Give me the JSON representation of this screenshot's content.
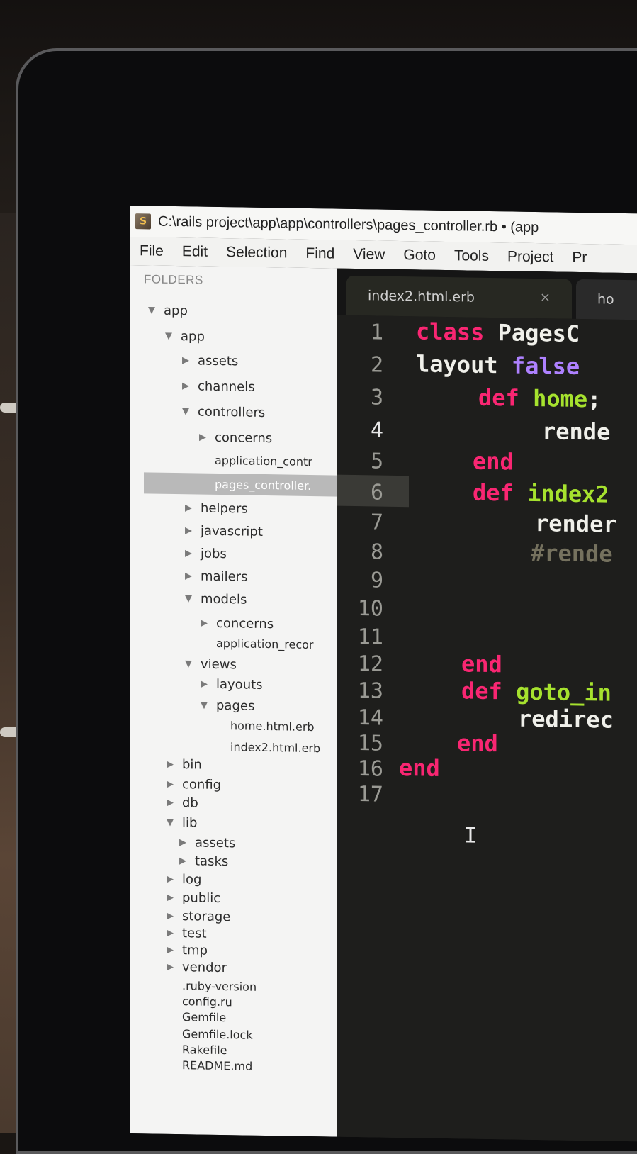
{
  "window": {
    "title": "C:\\rails project\\app\\app\\controllers\\pages_controller.rb • (app",
    "app_icon": "sublime-text-icon"
  },
  "menu": [
    "File",
    "Edit",
    "Selection",
    "Find",
    "View",
    "Goto",
    "Tools",
    "Project",
    "Pr"
  ],
  "sidebar": {
    "header": "FOLDERS",
    "items": [
      {
        "label": "app",
        "state": "open"
      },
      {
        "label": "app",
        "state": "open"
      },
      {
        "label": "assets",
        "state": "closed"
      },
      {
        "label": "channels",
        "state": "closed"
      },
      {
        "label": "controllers",
        "state": "open"
      },
      {
        "label": "concerns",
        "state": "closed"
      },
      {
        "label": "application_contr",
        "state": "file"
      },
      {
        "label": "pages_controller.",
        "state": "file",
        "selected": true
      },
      {
        "label": "helpers",
        "state": "closed"
      },
      {
        "label": "javascript",
        "state": "closed"
      },
      {
        "label": "jobs",
        "state": "closed"
      },
      {
        "label": "mailers",
        "state": "closed"
      },
      {
        "label": "models",
        "state": "open"
      },
      {
        "label": "concerns",
        "state": "closed"
      },
      {
        "label": "application_recor",
        "state": "file"
      },
      {
        "label": "views",
        "state": "open"
      },
      {
        "label": "layouts",
        "state": "closed"
      },
      {
        "label": "pages",
        "state": "open"
      },
      {
        "label": "home.html.erb",
        "state": "file"
      },
      {
        "label": "index2.html.erb",
        "state": "file"
      },
      {
        "label": "bin",
        "state": "closed"
      },
      {
        "label": "config",
        "state": "closed"
      },
      {
        "label": "db",
        "state": "closed"
      },
      {
        "label": "lib",
        "state": "open"
      },
      {
        "label": "assets",
        "state": "closed"
      },
      {
        "label": "tasks",
        "state": "closed"
      },
      {
        "label": "log",
        "state": "closed"
      },
      {
        "label": "public",
        "state": "closed"
      },
      {
        "label": "storage",
        "state": "closed"
      },
      {
        "label": "test",
        "state": "closed"
      },
      {
        "label": "tmp",
        "state": "closed"
      },
      {
        "label": "vendor",
        "state": "closed"
      },
      {
        "label": ".ruby-version",
        "state": "file"
      },
      {
        "label": "config.ru",
        "state": "file"
      },
      {
        "label": "Gemfile",
        "state": "file"
      },
      {
        "label": "Gemfile.lock",
        "state": "file"
      },
      {
        "label": "Rakefile",
        "state": "file"
      },
      {
        "label": "README.md",
        "state": "file"
      }
    ]
  },
  "tabs": [
    {
      "label": "index2.html.erb",
      "close": "×",
      "active": true
    },
    {
      "label": "ho",
      "active": false
    }
  ],
  "editor": {
    "current_line": 4,
    "line_numbers": [
      "1",
      "2",
      "3",
      "4",
      "5",
      "6",
      "7",
      "8",
      "9",
      "10",
      "11",
      "12",
      "13",
      "14",
      "15",
      "16",
      "17"
    ],
    "code": [
      [
        {
          "t": "kw",
          "v": "class"
        },
        {
          "t": "plain",
          "v": " PagesC"
        }
      ],
      [
        {
          "t": "plain",
          "v": "layout "
        },
        {
          "t": "con",
          "v": "false"
        }
      ],
      [
        {
          "t": "kw",
          "v": "def"
        },
        {
          "t": "plain",
          "v": " "
        },
        {
          "t": "fn",
          "v": "home"
        },
        {
          "t": "plain",
          "v": ";"
        }
      ],
      [
        {
          "t": "plain",
          "v": "rende"
        }
      ],
      [
        {
          "t": "kw",
          "v": "end"
        }
      ],
      [
        {
          "t": "kw",
          "v": "def"
        },
        {
          "t": "plain",
          "v": " "
        },
        {
          "t": "fn",
          "v": "index2"
        }
      ],
      [
        {
          "t": "plain",
          "v": "render"
        }
      ],
      [
        {
          "t": "cmt",
          "v": "#rende"
        }
      ],
      [],
      [],
      [],
      [
        {
          "t": "kw",
          "v": "end"
        }
      ],
      [
        {
          "t": "kw",
          "v": "def"
        },
        {
          "t": "plain",
          "v": " "
        },
        {
          "t": "fn",
          "v": "goto_in"
        }
      ],
      [
        {
          "t": "plain",
          "v": "redirec"
        }
      ],
      [
        {
          "t": "kw",
          "v": "end"
        }
      ],
      [
        {
          "t": "kw",
          "v": "end"
        }
      ],
      []
    ],
    "mouse_cursor": "I"
  }
}
